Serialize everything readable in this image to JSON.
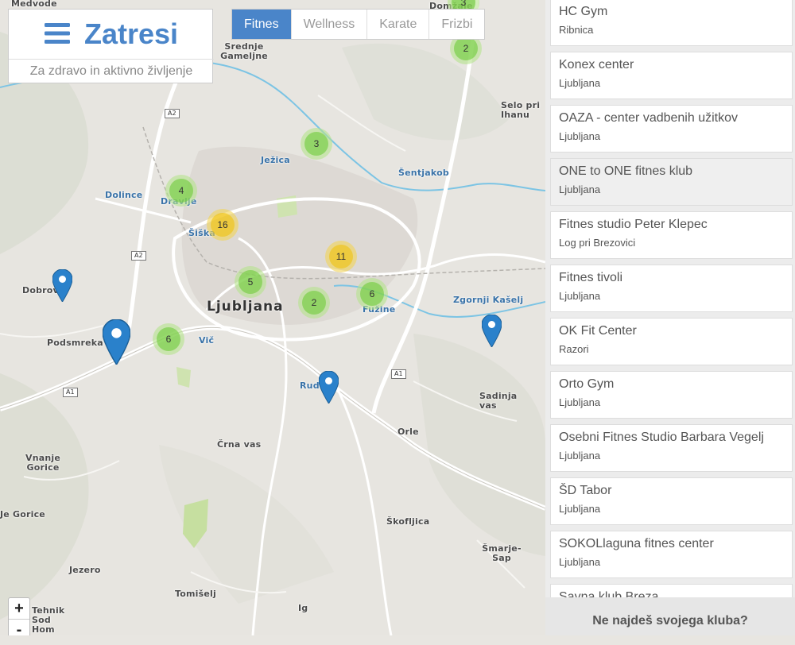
{
  "header": {
    "title": "Zatresi",
    "subtitle": "Za zdravo in aktivno življenje"
  },
  "tabs": [
    {
      "label": "Fitnes",
      "active": true
    },
    {
      "label": "Wellness",
      "active": false
    },
    {
      "label": "Karate",
      "active": false
    },
    {
      "label": "Frizbi",
      "active": false
    }
  ],
  "zoom": {
    "in_label": "+",
    "out_label": "-"
  },
  "map": {
    "places": [
      "Medvode",
      "Domžale",
      "Srednje Gameljne",
      "Ježica",
      "Šentjakob",
      "Selo pri Ihanu",
      "Dolince",
      "Dravlje",
      "Šiška",
      "Ljubljana",
      "Dobrova",
      "Podsmreka",
      "Vič",
      "Fužine",
      "Zgornji Kašelj",
      "Rudnik",
      "Sadinja vas",
      "Orle",
      "Črna vas",
      "Vnanje Gorice",
      "Je Gorice",
      "Škofljica",
      "Šmarje-Sap",
      "Jezero",
      "Tomišelj",
      "Ig",
      "Tehnik",
      "Sod",
      "Hom"
    ],
    "road_shields": [
      "A2",
      "A2",
      "A1",
      "A1"
    ],
    "clusters": [
      {
        "count": "3",
        "level": "green"
      },
      {
        "count": "2",
        "level": "green"
      },
      {
        "count": "3",
        "level": "green"
      },
      {
        "count": "4",
        "level": "green"
      },
      {
        "count": "16",
        "level": "yellow"
      },
      {
        "count": "11",
        "level": "yellow"
      },
      {
        "count": "5",
        "level": "green"
      },
      {
        "count": "2",
        "level": "green"
      },
      {
        "count": "6",
        "level": "green"
      },
      {
        "count": "6",
        "level": "green"
      }
    ],
    "marker_color": "#2a81cb"
  },
  "clubs": [
    {
      "name": "HC Gym",
      "city": "Ribnica"
    },
    {
      "name": "Konex center",
      "city": "Ljubljana"
    },
    {
      "name": "OAZA - center vadbenih užitkov",
      "city": "Ljubljana"
    },
    {
      "name": "ONE to ONE fitnes klub",
      "city": "Ljubljana"
    },
    {
      "name": "Fitnes studio Peter Klepec",
      "city": "Log pri Brezovici"
    },
    {
      "name": "Fitnes tivoli",
      "city": "Ljubljana"
    },
    {
      "name": "OK Fit Center",
      "city": "Razori"
    },
    {
      "name": "Orto Gym",
      "city": "Ljubljana"
    },
    {
      "name": "Osebni Fitnes Studio Barbara Vegelj",
      "city": "Ljubljana"
    },
    {
      "name": "ŠD Tabor",
      "city": "Ljubljana"
    },
    {
      "name": "SOKOLlaguna fitnes center",
      "city": "Ljubljana"
    },
    {
      "name": "Savna klub Breza",
      "city": ""
    }
  ],
  "footer": {
    "label": "Ne najdeš svojega kluba?"
  },
  "colors": {
    "accent": "#4a85c9",
    "cluster_green": "#6ecc39",
    "cluster_yellow": "#f0c20c"
  }
}
